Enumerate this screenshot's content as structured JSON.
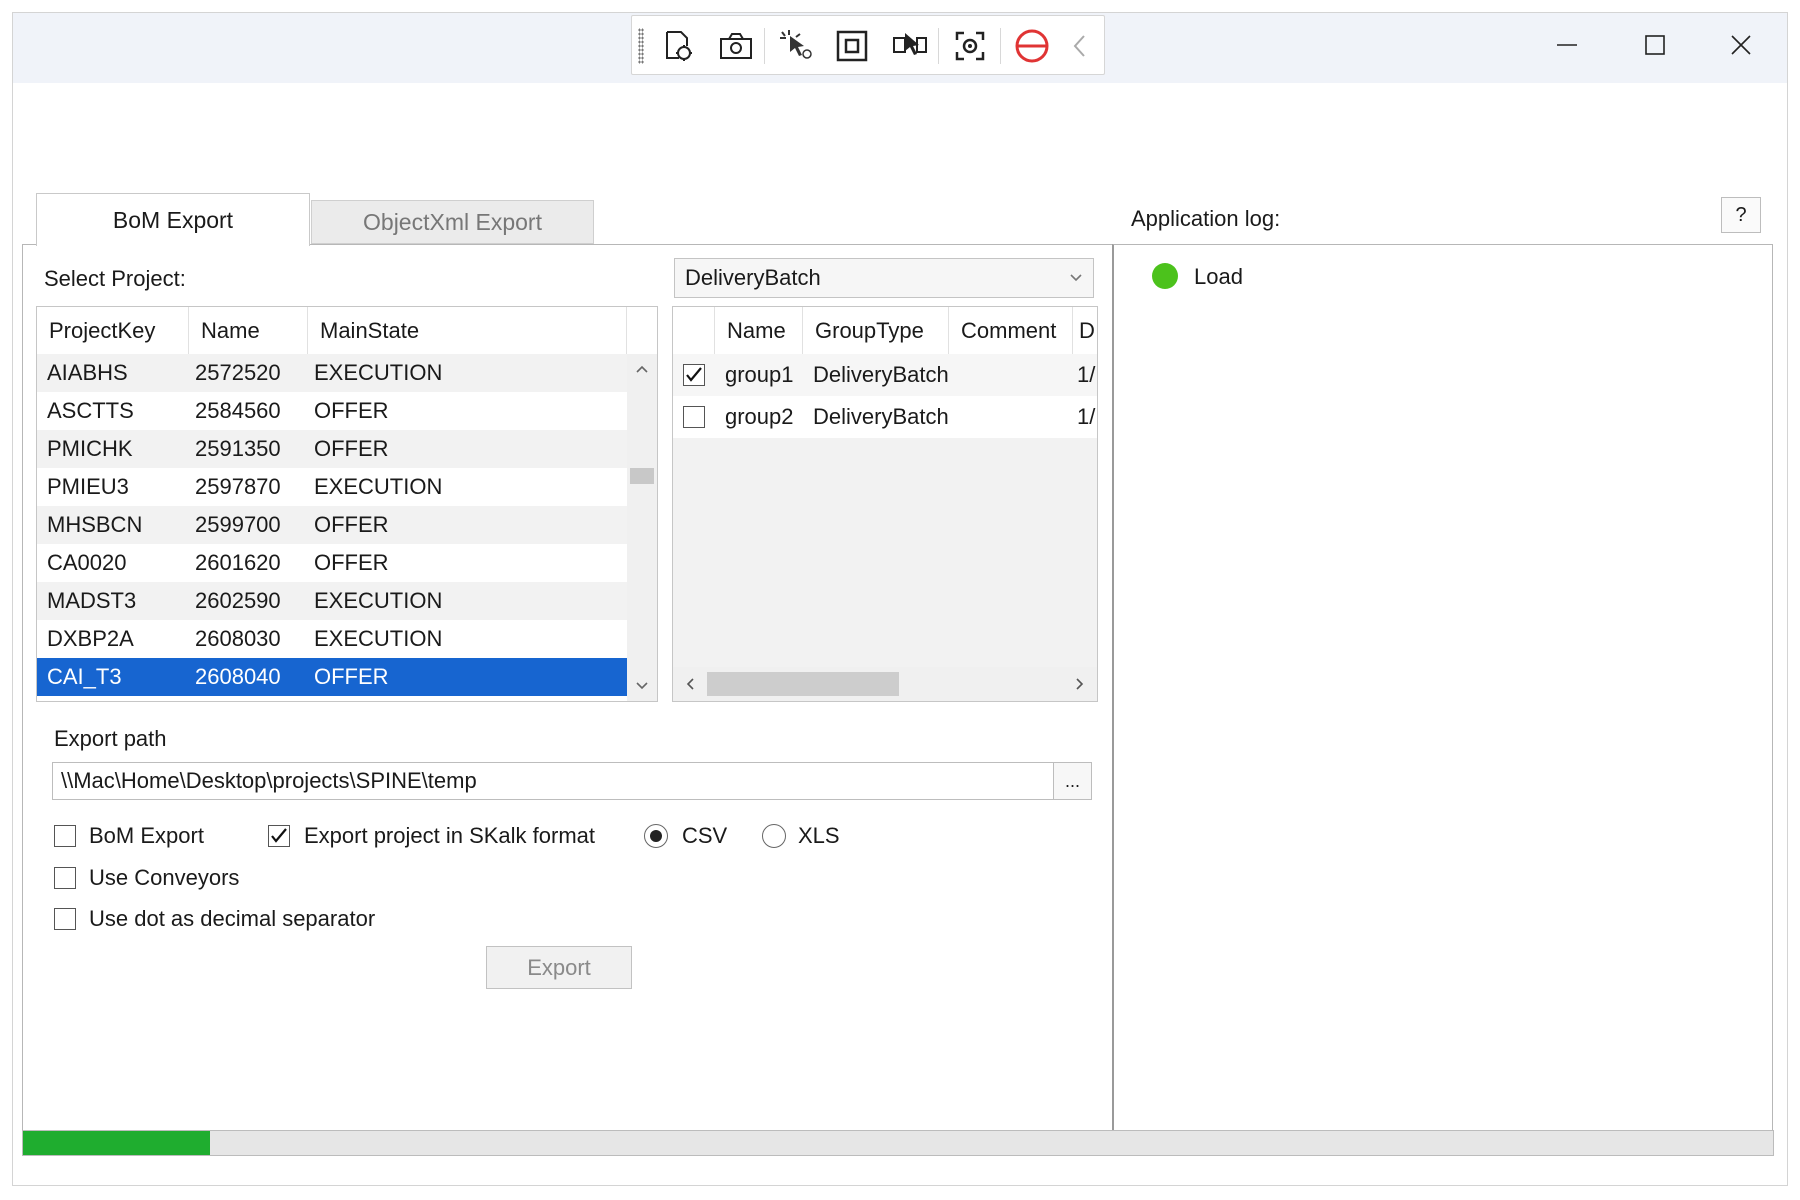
{
  "toolbar": {
    "icons": [
      "grip-icon",
      "select-element-icon",
      "screenshot-icon",
      "pointer-icon",
      "frame-icon",
      "element-capture-icon",
      "target-icon",
      "stop-icon",
      "collapse-icon"
    ]
  },
  "window_controls": {
    "minimize": "—",
    "maximize": "☐",
    "close": "✕"
  },
  "tabs": [
    {
      "label": "BoM Export",
      "active": true
    },
    {
      "label": "ObjectXml Export",
      "active": false
    }
  ],
  "select_project_label": "Select Project:",
  "group_type_dropdown": {
    "value": "DeliveryBatch"
  },
  "projects": {
    "headers": [
      "ProjectKey",
      "Name",
      "MainState"
    ],
    "rows": [
      [
        "AIABHS",
        "2572520",
        "EXECUTION"
      ],
      [
        "ASCTTS",
        "2584560",
        "OFFER"
      ],
      [
        "PMICHK",
        "2591350",
        "OFFER"
      ],
      [
        "PMIEU3",
        "2597870",
        "EXECUTION"
      ],
      [
        "MHSBCN",
        "2599700",
        "OFFER"
      ],
      [
        "CA0020",
        "2601620",
        "OFFER"
      ],
      [
        "MADST3",
        "2602590",
        "EXECUTION"
      ],
      [
        "DXBP2A",
        "2608030",
        "EXECUTION"
      ],
      [
        "CAI_T3",
        "2608040",
        "OFFER"
      ]
    ],
    "selected_index": 8
  },
  "groups": {
    "headers": [
      "Name",
      "GroupType",
      "Comment",
      "D"
    ],
    "rows": [
      {
        "checked": true,
        "name": "group1",
        "type": "DeliveryBatch",
        "comment": "",
        "d": "1/"
      },
      {
        "checked": false,
        "name": "group2",
        "type": "DeliveryBatch",
        "comment": "",
        "d": "1/"
      }
    ]
  },
  "export_path": {
    "label": "Export path",
    "value": "\\\\Mac\\Home\\Desktop\\projects\\SPINE\\temp",
    "browse": "..."
  },
  "options": {
    "bom_export": {
      "label": "BoM Export",
      "checked": false
    },
    "skalk": {
      "label": "Export project in SKalk format",
      "checked": true
    },
    "csv": {
      "label": "CSV",
      "selected": true
    },
    "xls": {
      "label": "XLS",
      "selected": false
    },
    "use_conveyors": {
      "label": "Use Conveyors",
      "checked": false
    },
    "use_dot": {
      "label": "Use dot as decimal separator",
      "checked": false
    }
  },
  "export_button": "Export",
  "app_log": {
    "label": "Application log:",
    "help": "?",
    "entries": [
      {
        "status": "ok",
        "text": "Load"
      }
    ]
  },
  "progress_fraction": 0.107,
  "colors": {
    "selection": "#1765d0",
    "progress": "#1fad2f",
    "status_ok": "#4cc21c",
    "stop": "#e03434"
  }
}
